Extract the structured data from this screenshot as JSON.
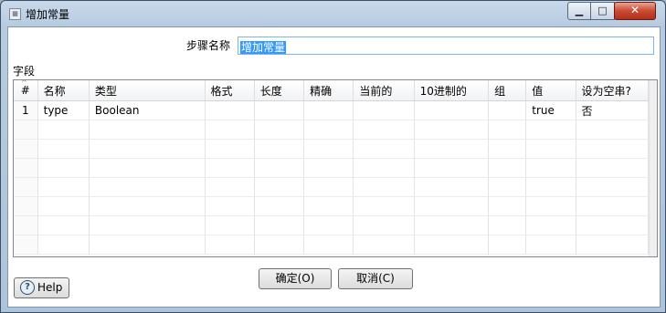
{
  "window": {
    "title": "增加常量",
    "minimize_glyph": "▁",
    "maximize_glyph": "□",
    "close_glyph": "✕"
  },
  "form": {
    "step_name_label": "步骤名称",
    "step_name_value": "增加常量"
  },
  "fields": {
    "label": "字段",
    "columns": [
      "#",
      "名称",
      "类型",
      "格式",
      "长度",
      "精确",
      "当前的",
      "10进制的",
      "组",
      "值",
      "设为空串?"
    ],
    "rows": [
      [
        "1",
        "type",
        "Boolean",
        "",
        "",
        "",
        "",
        "",
        "",
        "true",
        "否"
      ]
    ],
    "empty_rows": 7
  },
  "buttons": {
    "ok": "确定(O)",
    "cancel": "取消(C)",
    "help": "Help",
    "help_icon_glyph": "?"
  }
}
